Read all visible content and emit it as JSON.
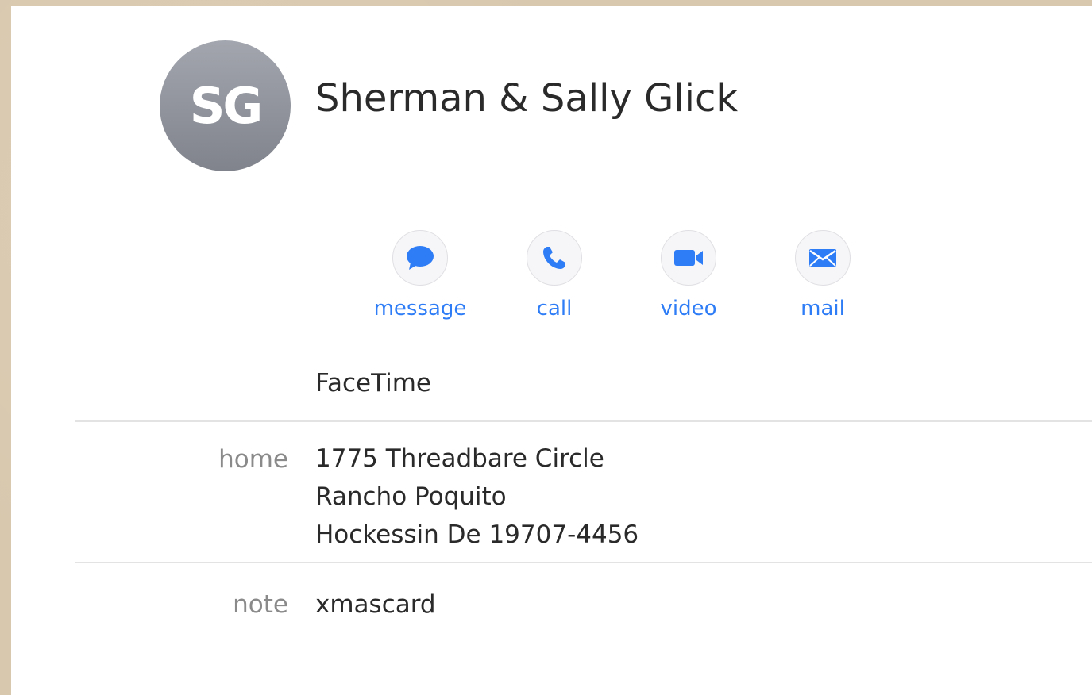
{
  "contact": {
    "initials": "SG",
    "name": "Sherman & Sally Glick"
  },
  "actions": [
    {
      "label": "message",
      "icon": "message-bubble-icon"
    },
    {
      "label": "call",
      "icon": "phone-icon"
    },
    {
      "label": "video",
      "icon": "video-camera-icon"
    },
    {
      "label": "mail",
      "icon": "envelope-icon"
    }
  ],
  "facetime": {
    "label": "FaceTime"
  },
  "fields": {
    "home": {
      "label": "home",
      "lines": [
        "1775 Threadbare Circle",
        "Rancho Poquito",
        "Hockessin De 19707-4456"
      ]
    },
    "note": {
      "label": "note",
      "value": "xmascard"
    }
  },
  "colors": {
    "accent": "#2f7df6",
    "avatar_top": "#a3a6ae",
    "avatar_bottom": "#80838c",
    "background": "#d8c8ae",
    "label_gray": "#8a8a8a"
  }
}
